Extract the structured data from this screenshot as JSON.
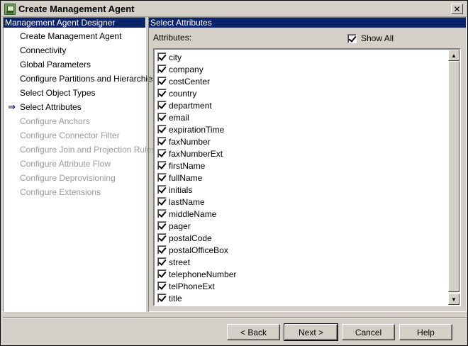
{
  "window": {
    "title": "Create Management Agent",
    "close_label": "✕"
  },
  "left_pane": {
    "header": "Management Agent Designer",
    "current_marker": "⇒",
    "steps": [
      {
        "label": "Create Management Agent",
        "enabled": true,
        "current": false
      },
      {
        "label": "Connectivity",
        "enabled": true,
        "current": false
      },
      {
        "label": "Global Parameters",
        "enabled": true,
        "current": false
      },
      {
        "label": "Configure Partitions and Hierarchies",
        "enabled": true,
        "current": false
      },
      {
        "label": "Select Object Types",
        "enabled": true,
        "current": false
      },
      {
        "label": "Select Attributes",
        "enabled": true,
        "current": true
      },
      {
        "label": "Configure Anchors",
        "enabled": false,
        "current": false
      },
      {
        "label": "Configure Connector Filter",
        "enabled": false,
        "current": false
      },
      {
        "label": "Configure Join and Projection Rules",
        "enabled": false,
        "current": false
      },
      {
        "label": "Configure Attribute Flow",
        "enabled": false,
        "current": false
      },
      {
        "label": "Configure Deprovisioning",
        "enabled": false,
        "current": false
      },
      {
        "label": "Configure Extensions",
        "enabled": false,
        "current": false
      }
    ]
  },
  "right_pane": {
    "header": "Select Attributes",
    "attributes_label": "Attributes:",
    "show_all_label": "Show All",
    "show_all_checked": true,
    "attributes": [
      {
        "name": "city",
        "checked": true
      },
      {
        "name": "company",
        "checked": true
      },
      {
        "name": "costCenter",
        "checked": true
      },
      {
        "name": "country",
        "checked": true
      },
      {
        "name": "department",
        "checked": true
      },
      {
        "name": "email",
        "checked": true
      },
      {
        "name": "expirationTime",
        "checked": true
      },
      {
        "name": "faxNumber",
        "checked": true
      },
      {
        "name": "faxNumberExt",
        "checked": true
      },
      {
        "name": "firstName",
        "checked": true
      },
      {
        "name": "fullName",
        "checked": true
      },
      {
        "name": "initials",
        "checked": true
      },
      {
        "name": "lastName",
        "checked": true
      },
      {
        "name": "middleName",
        "checked": true
      },
      {
        "name": "pager",
        "checked": true
      },
      {
        "name": "postalCode",
        "checked": true
      },
      {
        "name": "postalOfficeBox",
        "checked": true
      },
      {
        "name": "street",
        "checked": true
      },
      {
        "name": "telephoneNumber",
        "checked": true
      },
      {
        "name": "telPhoneExt",
        "checked": true
      },
      {
        "name": "title",
        "checked": true
      }
    ]
  },
  "buttons": {
    "back": "< Back",
    "next": "Next >",
    "cancel": "Cancel",
    "help": "Help"
  }
}
